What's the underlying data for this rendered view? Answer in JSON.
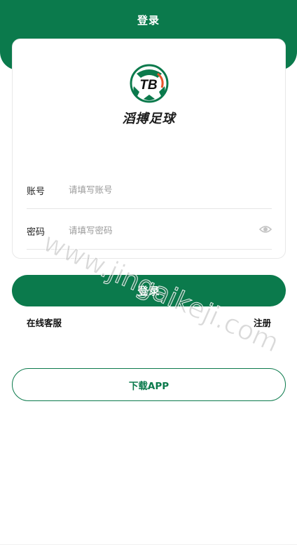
{
  "header": {
    "title": "登录"
  },
  "brand": {
    "logo_text": "TB",
    "name": "滔搏足球"
  },
  "form": {
    "account_label": "账号",
    "account_placeholder": "请填写账号",
    "password_label": "密码",
    "password_placeholder": "请填写密码",
    "eye_icon": "eye-icon"
  },
  "actions": {
    "login_label": "登录",
    "service_label": "在线客服",
    "register_label": "注册",
    "download_label": "下载APP"
  },
  "watermark": "www.jingaikeji.com",
  "colors": {
    "brand_green": "#0b7a4c",
    "accent_orange": "#e8532b"
  }
}
